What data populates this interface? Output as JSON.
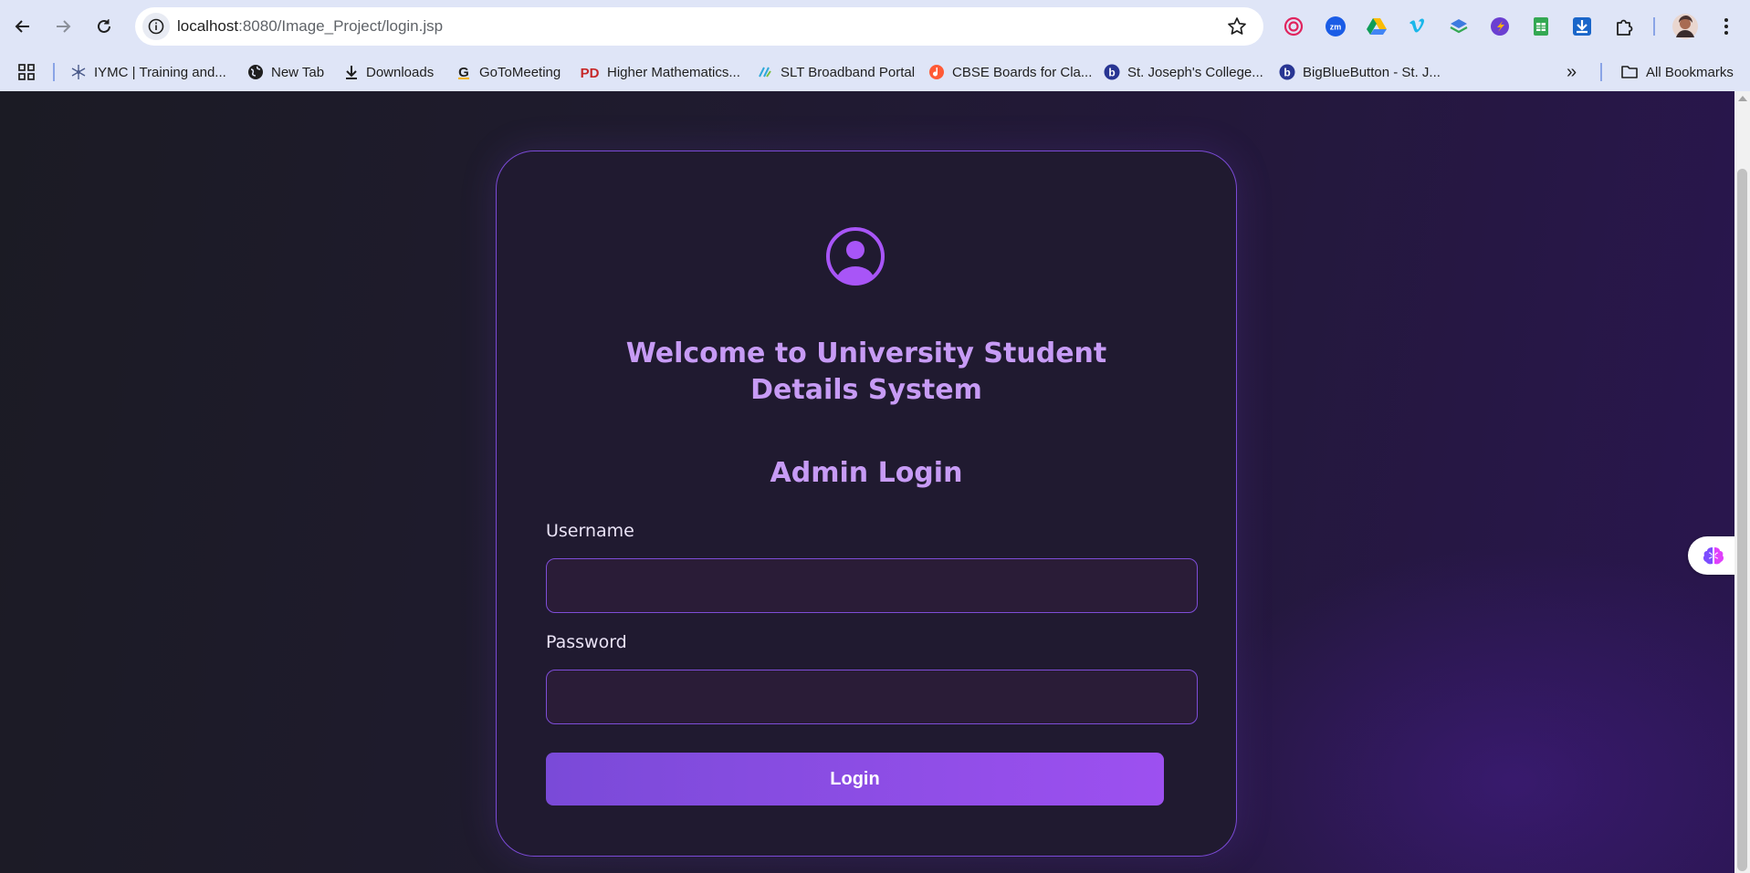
{
  "browser": {
    "url_host": "localhost",
    "url_rest": ":8080/Image_Project/login.jsp",
    "nav": {
      "back_icon": "arrow-left-icon",
      "forward_icon": "arrow-right-icon",
      "reload_icon": "reload-icon"
    },
    "extensions": [
      "target-icon",
      "zoom-icon",
      "google-drive-icon",
      "vimeo-icon",
      "layers-icon",
      "compass-icon",
      "sheets-icon",
      "download-icon",
      "puzzle-icon"
    ]
  },
  "bookmarks": {
    "items": [
      {
        "label": "IYMC | Training and..."
      },
      {
        "label": "New Tab"
      },
      {
        "label": "Downloads"
      },
      {
        "label": "GoToMeeting"
      },
      {
        "label": "Higher Mathematics..."
      },
      {
        "label": "SLT Broadband Portal"
      },
      {
        "label": "CBSE Boards for Cla..."
      },
      {
        "label": "St. Joseph's College..."
      },
      {
        "label": "BigBlueButton - St. J..."
      }
    ],
    "overflow": "»",
    "all_bookmarks": "All Bookmarks"
  },
  "login": {
    "welcome": "Welcome to University Student Details System",
    "heading": "Admin Login",
    "username_label": "Username",
    "username_value": "",
    "password_label": "Password",
    "password_value": "",
    "submit_label": "Login"
  },
  "colors": {
    "accent": "#9d50f0",
    "title": "#c79bf5",
    "card_border": "#7b4ad6"
  }
}
